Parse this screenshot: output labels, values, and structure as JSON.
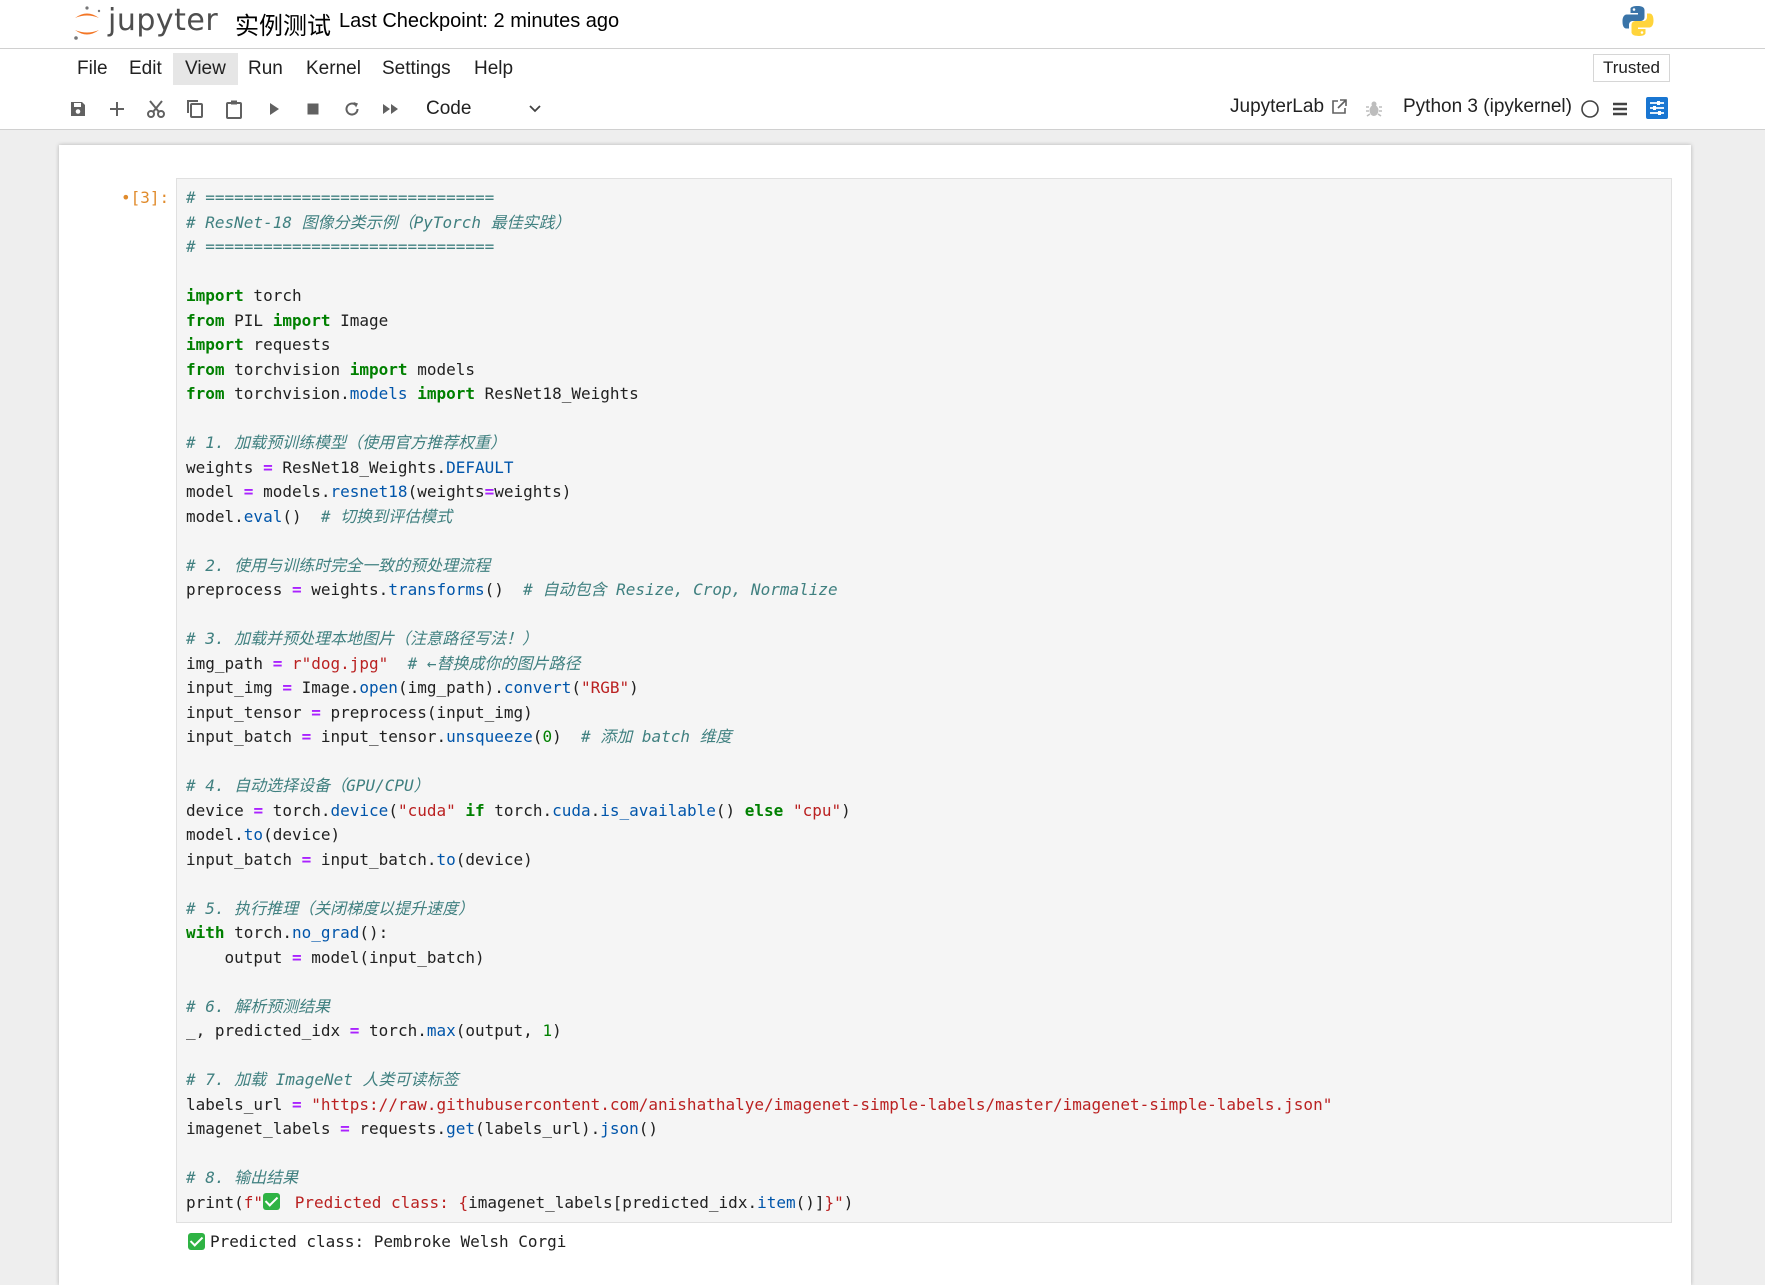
{
  "header": {
    "app_name": "jupyter",
    "notebook_title": "实例测试",
    "checkpoint": "Last Checkpoint: 2 minutes ago"
  },
  "menu": {
    "items": [
      "File",
      "Edit",
      "View",
      "Run",
      "Kernel",
      "Settings",
      "Help"
    ],
    "active": "View",
    "trusted": "Trusted"
  },
  "toolbar": {
    "buttons": [
      "save-icon",
      "add-cell-icon",
      "cut-icon",
      "copy-icon",
      "paste-icon",
      "run-icon",
      "stop-icon",
      "restart-icon",
      "run-all-icon"
    ],
    "cell_type": "Code",
    "jupyterlab_link": "JupyterLab",
    "kernel_name": "Python 3 (ipykernel)"
  },
  "colors": {
    "accent": "#f37626",
    "comment": "#408080",
    "keyword": "#008000",
    "string": "#ba2121",
    "method": "#0055aa",
    "prompt": "#e08b2c"
  },
  "cell": {
    "prompt": "•[3]:",
    "code_lines": [
      "# ==============================",
      "# ResNet-18 图像分类示例（PyTorch 最佳实践）",
      "# ==============================",
      "",
      "import torch",
      "from PIL import Image",
      "import requests",
      "from torchvision import models",
      "from torchvision.models import ResNet18_Weights",
      "",
      "# 1. 加载预训练模型（使用官方推荐权重）",
      "weights = ResNet18_Weights.DEFAULT",
      "model = models.resnet18(weights=weights)",
      "model.eval()  # 切换到评估模式",
      "",
      "# 2. 使用与训练时完全一致的预处理流程",
      "preprocess = weights.transforms()  # 自动包含 Resize, Crop, Normalize",
      "",
      "# 3. 加载并预处理本地图片（注意路径写法！）",
      "img_path = r\"dog.jpg\"  # ←替换成你的图片路径",
      "input_img = Image.open(img_path).convert(\"RGB\")",
      "input_tensor = preprocess(input_img)",
      "input_batch = input_tensor.unsqueeze(0)  # 添加 batch 维度",
      "",
      "# 4. 自动选择设备（GPU/CPU）",
      "device = torch.device(\"cuda\" if torch.cuda.is_available() else \"cpu\")",
      "model.to(device)",
      "input_batch = input_batch.to(device)",
      "",
      "# 5. 执行推理（关闭梯度以提升速度）",
      "with torch.no_grad():",
      "    output = model(input_batch)",
      "",
      "# 6. 解析预测结果",
      "_, predicted_idx = torch.max(output, 1)",
      "",
      "# 7. 加载 ImageNet 人类可读标签",
      "labels_url = \"https://raw.githubusercontent.com/anishathalye/imagenet-simple-labels/master/imagenet-simple-labels.json\"",
      "imagenet_labels = requests.get(labels_url).json()",
      "",
      "# 8. 输出结果",
      "print(f\"✅ Predicted class: {imagenet_labels[predicted_idx.item()]}\")"
    ],
    "output_text": "Predicted class: Pembroke Welsh Corgi",
    "output_emoji": "check-mark-icon"
  }
}
